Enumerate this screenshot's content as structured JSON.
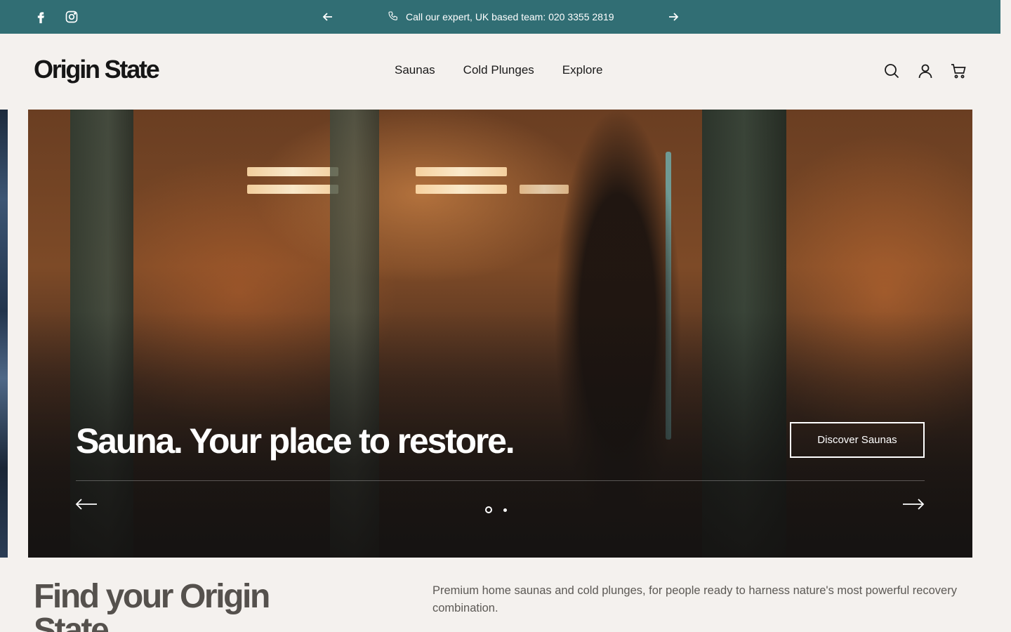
{
  "announcement": {
    "text": "Call our expert, UK based team: 020 3355 2819",
    "icons": {
      "facebook": "facebook-icon",
      "instagram": "instagram-icon",
      "phone": "phone-icon",
      "prev": "arrow-left-icon",
      "next": "arrow-right-icon"
    },
    "background": "#316e74"
  },
  "header": {
    "logo": "Origin State",
    "nav": [
      "Saunas",
      "Cold Plunges",
      "Explore"
    ],
    "icons": [
      "search-icon",
      "account-icon",
      "cart-icon"
    ]
  },
  "hero": {
    "title": "Sauna. Your place to restore.",
    "button": "Discover Saunas",
    "slides_total": 2,
    "active_slide": 1
  },
  "intro": {
    "title": "Find your Origin State",
    "text": "Premium home saunas and cold plunges, for people ready to harness nature's most powerful recovery combination."
  }
}
